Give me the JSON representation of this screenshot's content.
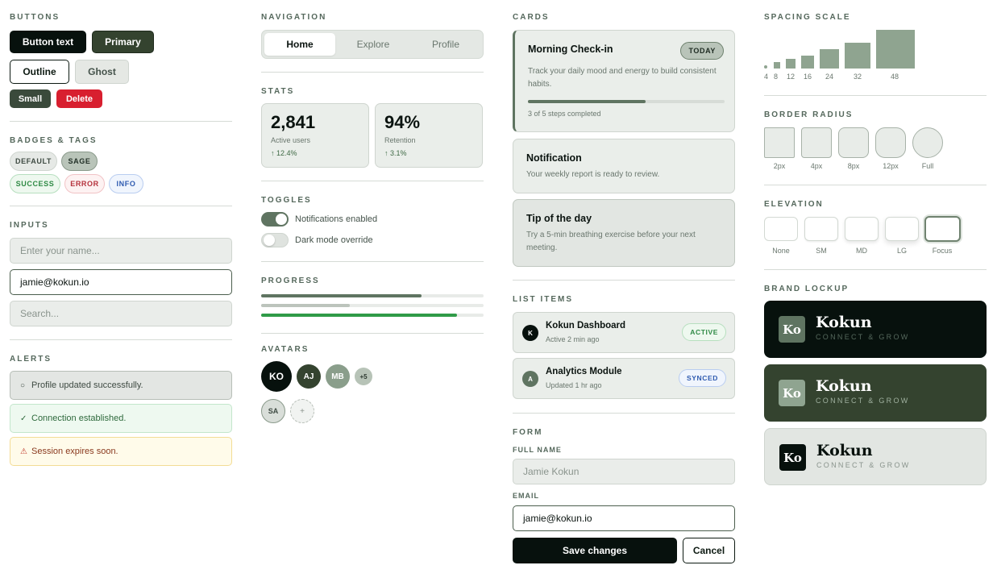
{
  "buttons": {
    "section": "BUTTONS",
    "button_text": "Button text",
    "primary": "Primary",
    "outline": "Outline",
    "ghost": "Ghost",
    "small": "Small",
    "delete": "Delete"
  },
  "badges": {
    "section": "BADGES & TAGS",
    "items": [
      "DEFAULT",
      "SAGE",
      "SUCCESS",
      "ERROR",
      "INFO"
    ]
  },
  "inputs": {
    "section": "INPUTS",
    "name_placeholder": "Enter your name...",
    "email_value": "jamie@kokun.io",
    "search_placeholder": "Search..."
  },
  "alerts": {
    "section": "ALERTS",
    "items": [
      {
        "icon": "○",
        "text": "Profile updated successfully."
      },
      {
        "icon": "✓",
        "text": "Connection established."
      },
      {
        "icon": "⚠",
        "text": "Session expires soon."
      }
    ]
  },
  "navigation": {
    "section": "NAVIGATION",
    "tabs": [
      "Home",
      "Explore",
      "Profile"
    ],
    "active": "Home"
  },
  "stats": {
    "section": "STATS",
    "items": [
      {
        "value": "2,841",
        "label": "Active users",
        "delta": "↑ 12.4%"
      },
      {
        "value": "94%",
        "label": "Retention",
        "delta": "↑ 3.1%"
      }
    ]
  },
  "toggles": {
    "section": "TOGGLES",
    "items": [
      {
        "label": "Notifications enabled",
        "on": true
      },
      {
        "label": "Dark mode override",
        "on": false
      }
    ]
  },
  "progress": {
    "section": "PROGRESS",
    "bars": [
      {
        "fraction": 0.72,
        "color": "#5f7461"
      },
      {
        "fraction": 0.4,
        "color": "#bcc4bc"
      },
      {
        "fraction": 0.88,
        "color": "#2f9b48"
      }
    ]
  },
  "avatars": {
    "section": "AVATARS",
    "items": [
      "KO",
      "AJ",
      "MB",
      "+5",
      "SA",
      "+"
    ]
  },
  "cards": {
    "section": "CARDS",
    "checkin": {
      "title": "Morning Check-in",
      "badge": "TODAY",
      "body": "Track your daily mood and energy to build consistent habits.",
      "progress": 0.6,
      "steps": "3 of 5 steps completed"
    },
    "notification": {
      "title": "Notification",
      "body": "Your weekly report is ready to review."
    },
    "tip": {
      "title": "Tip of the day",
      "body": "Try a 5-min breathing exercise before your next meeting."
    }
  },
  "list": {
    "section": "LIST ITEMS",
    "items": [
      {
        "initial": "K",
        "name": "Kokun Dashboard",
        "sub": "Active 2 min ago",
        "tag": "ACTIVE"
      },
      {
        "initial": "A",
        "name": "Analytics Module",
        "sub": "Updated 1 hr ago",
        "tag": "SYNCED"
      }
    ]
  },
  "form": {
    "section": "FORM",
    "full_name_label": "FULL NAME",
    "full_name_placeholder": "Jamie Kokun",
    "email_label": "EMAIL",
    "email_value": "jamie@kokun.io",
    "save": "Save changes",
    "cancel": "Cancel"
  },
  "spacing": {
    "section": "SPACING SCALE",
    "steps": [
      "4",
      "8",
      "12",
      "16",
      "24",
      "32",
      "48"
    ]
  },
  "radius": {
    "section": "BORDER RADIUS",
    "items": [
      "2px",
      "4px",
      "8px",
      "12px",
      "Full"
    ]
  },
  "elevation": {
    "section": "ELEVATION",
    "items": [
      "None",
      "SM",
      "MD",
      "LG",
      "Focus"
    ]
  },
  "brand": {
    "section": "BRAND LOCKUP",
    "mark": "Ko",
    "name": "Kokun",
    "tagline": "CONNECT & GROW"
  },
  "colors": {
    "ink": "#07110d",
    "forest": "#34432f",
    "sage": "#5f7461",
    "mist": "#eaeeea",
    "danger": "#d81f2f",
    "success": "#2f9b48"
  }
}
